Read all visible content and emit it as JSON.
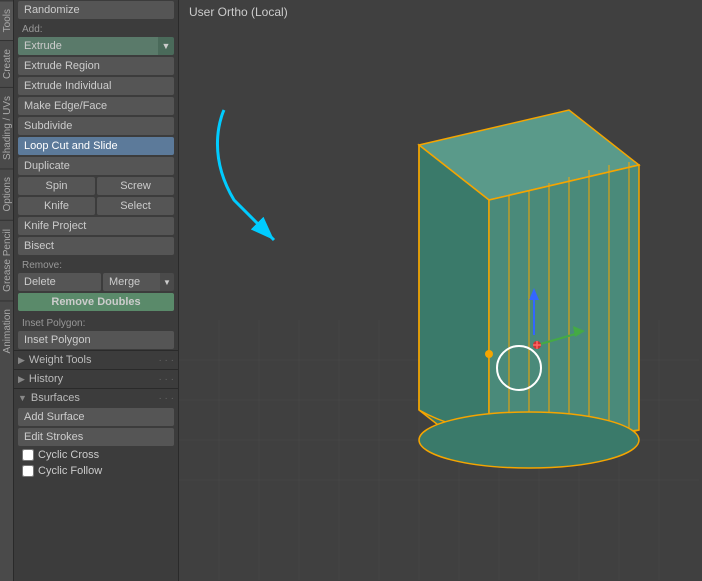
{
  "vtabs": [
    "Tools",
    "Create",
    "Shading / UVs",
    "Options",
    "Grease Pencil",
    "Animation"
  ],
  "viewport": {
    "header": "User Ortho (Local)"
  },
  "sidebar": {
    "randomize_label": "Randomize",
    "add_label": "Add:",
    "extrude_label": "Extrude",
    "extrude_region_label": "Extrude Region",
    "extrude_individual_label": "Extrude Individual",
    "make_edge_face_label": "Make Edge/Face",
    "subdivide_label": "Subdivide",
    "loop_cut_label": "Loop Cut and Slide",
    "duplicate_label": "Duplicate",
    "spin_label": "Spin",
    "screw_label": "Screw",
    "knife_label": "Knife",
    "select_label": "Select",
    "knife_project_label": "Knife Project",
    "bisect_label": "Bisect",
    "remove_label": "Remove:",
    "delete_label": "Delete",
    "merge_label": "Merge",
    "remove_doubles_label": "Remove Doubles",
    "inset_polygon_section": "Inset Polygon:",
    "inset_polygon_btn": "Inset Polygon",
    "weight_tools_label": "Weight Tools",
    "history_label": "History",
    "bsurfaces_label": "Bsurfaces",
    "add_surface_label": "Add Surface",
    "edit_strokes_label": "Edit Strokes",
    "cyclic_cross_label": "Cyclic Cross",
    "cyclic_follow_label": "Cyclic Follow"
  }
}
